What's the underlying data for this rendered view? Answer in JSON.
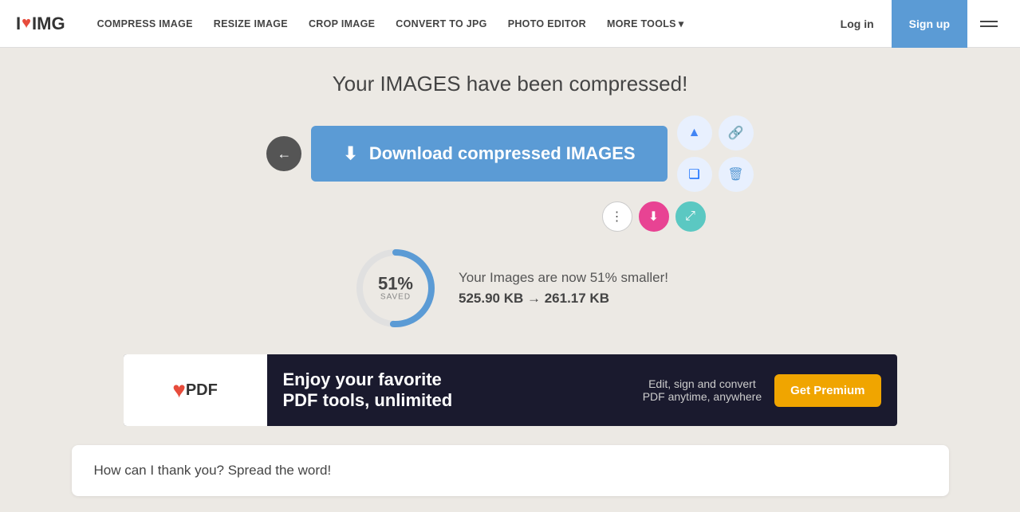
{
  "brand": {
    "logo_i": "I",
    "logo_heart": "♥",
    "logo_img": "IMG"
  },
  "navbar": {
    "links": [
      {
        "id": "compress",
        "label": "COMPRESS IMAGE"
      },
      {
        "id": "resize",
        "label": "RESIZE IMAGE"
      },
      {
        "id": "crop",
        "label": "CROP IMAGE"
      },
      {
        "id": "convert",
        "label": "CONVERT TO JPG"
      },
      {
        "id": "photo",
        "label": "PHOTO EDITOR"
      },
      {
        "id": "more",
        "label": "MORE TOOLS"
      }
    ],
    "login_label": "Log in",
    "signup_label": "Sign up"
  },
  "main": {
    "title": "Your IMAGES have been compressed!",
    "download_btn": "Download compressed IMAGES",
    "stats_text": "Your Images are now 51% smaller!",
    "stats_sizes": "525.90 KB → 261.17 KB",
    "percent": "51%",
    "saved_label": "SAVED",
    "progress_pct": 51
  },
  "ad": {
    "logo_text": "PDF",
    "headline_line1": "Enjoy your favorite",
    "headline_line2": "PDF tools, unlimited",
    "sub_text_line1": "Edit, sign and convert",
    "sub_text_line2": "PDF anytime, anywhere",
    "cta": "Get Premium"
  },
  "bottom": {
    "title": "How can I thank you? Spread the word!"
  },
  "icons": {
    "back_arrow": "←",
    "download": "⬇",
    "gdrive": "▲",
    "link": "🔗",
    "dropbox": "❑",
    "delete": "🗑",
    "more_dots": "⋮",
    "download_small": "⬇",
    "resize_icon": "⤢"
  }
}
